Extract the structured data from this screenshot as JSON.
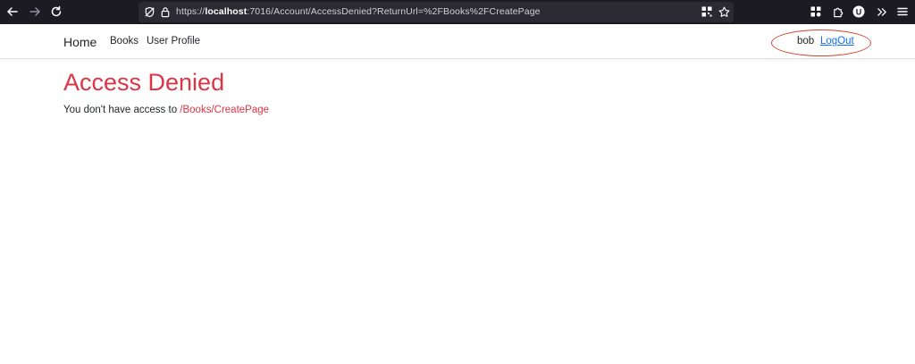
{
  "browser": {
    "url_prefix": "https://",
    "url_host": "localhost",
    "url_rest": ":7016/Account/AccessDenied?ReturnUrl=%2FBooks%2FCreatePage",
    "icons": {
      "back": "arrow-left-icon",
      "forward": "arrow-right-icon",
      "reload": "reload-icon",
      "tracking": "shield-icon",
      "lock": "lock-icon",
      "qr": "qr-code-icon",
      "bookmark": "star-icon",
      "extensions": "extensions-icon",
      "puzzle": "puzzle-icon",
      "profile": "profile-icon",
      "overflow": "chevrons-right-icon",
      "menu": "hamburger-menu-icon"
    },
    "profile_letter": "U"
  },
  "nav": {
    "brand": "Home",
    "links": [
      "Books",
      "User Profile"
    ],
    "user": "bob",
    "logout": "LogOut"
  },
  "main": {
    "title": "Access Denied",
    "message": "You don't have access to",
    "path": "/Books/CreatePage"
  },
  "colors": {
    "danger": "#dc3545",
    "link": "#0d6efd",
    "annotation": "#d9442e",
    "chrome": "#1c1b22"
  }
}
